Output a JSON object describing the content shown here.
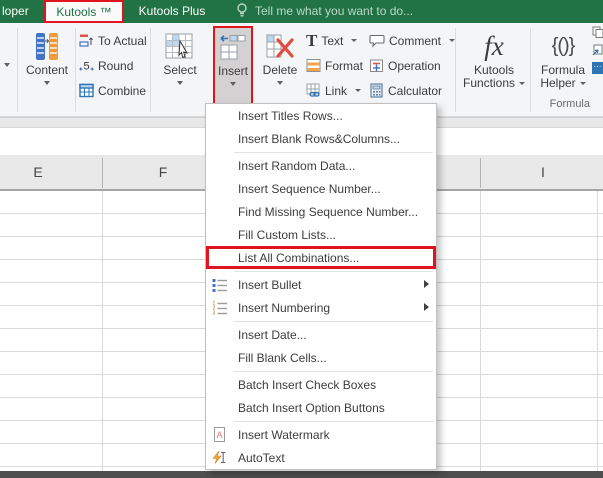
{
  "titlebar": {
    "partial_tab_label": "loper",
    "active_tab": "Kutools ™",
    "second_tab": "Kutools Plus",
    "tellme_text": "Tell me what you want to do...",
    "colors": {
      "green": "#217346",
      "highlight_red": "#e0141e"
    }
  },
  "ribbon": {
    "content_button": "Content",
    "group1": [
      {
        "label": "To Actual"
      },
      {
        "label": "Round"
      },
      {
        "label": "Combine"
      }
    ],
    "select_button": "Select",
    "insert_button": "Insert",
    "delete_button": "Delete",
    "group2": [
      {
        "label": "Text"
      },
      {
        "label": "Format"
      },
      {
        "label": "Link"
      }
    ],
    "group3": [
      {
        "label": "Comment"
      },
      {
        "label": "Operation"
      },
      {
        "label": "Calculator"
      }
    ],
    "kutools_functions": {
      "line1": "Kutools",
      "line2": "Functions"
    },
    "formula_helper": {
      "line1": "Formula",
      "line2": "Helper"
    },
    "group_label": "Formula",
    "icons": {
      "fx_glyph": "fx",
      "braces_glyph": "{()}",
      "text_glyph": "T",
      "round_digit": "5",
      "more_dots": "···"
    }
  },
  "menu": {
    "items": [
      {
        "label": "Insert Titles Rows..."
      },
      {
        "label": "Insert Blank Rows&Columns..."
      },
      {
        "separator": true
      },
      {
        "label": "Insert Random Data..."
      },
      {
        "label": "Insert Sequence Number..."
      },
      {
        "label": "Find Missing Sequence Number..."
      },
      {
        "label": "Fill Custom Lists..."
      },
      {
        "label": "List All Combinations...",
        "highlighted": true
      },
      {
        "separator": true
      },
      {
        "label": "Insert Bullet",
        "icon": "bullet-list",
        "has_submenu": true
      },
      {
        "label": "Insert Numbering",
        "icon": "numbered-list",
        "has_submenu": true
      },
      {
        "separator": true
      },
      {
        "label": "Insert Date..."
      },
      {
        "label": "Fill Blank Cells..."
      },
      {
        "separator": true
      },
      {
        "label": "Batch Insert Check Boxes"
      },
      {
        "label": "Batch Insert Option Buttons"
      },
      {
        "separator": true
      },
      {
        "label": "Insert Watermark",
        "icon": "watermark"
      },
      {
        "label": "AutoText",
        "icon": "autotext"
      }
    ]
  },
  "sheet": {
    "visible_columns": [
      {
        "label": "E"
      },
      {
        "label": "F"
      },
      {
        "label": "I"
      }
    ]
  }
}
